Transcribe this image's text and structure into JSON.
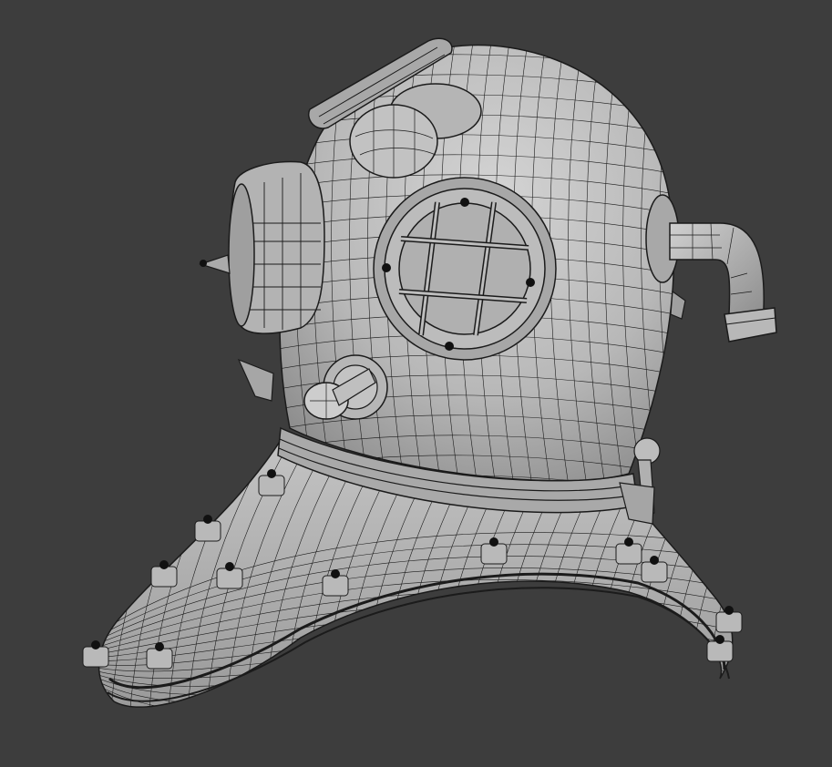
{
  "scene": {
    "subject": "diving-helmet-wireframe",
    "colors": {
      "background": "#3d3d3d",
      "surface": "#b9b9b9",
      "surface_shadow": "#8a8a8a",
      "surface_highlight": "#d6d6d6",
      "wire": "#1b1b1b",
      "bolt": "#111111"
    }
  }
}
